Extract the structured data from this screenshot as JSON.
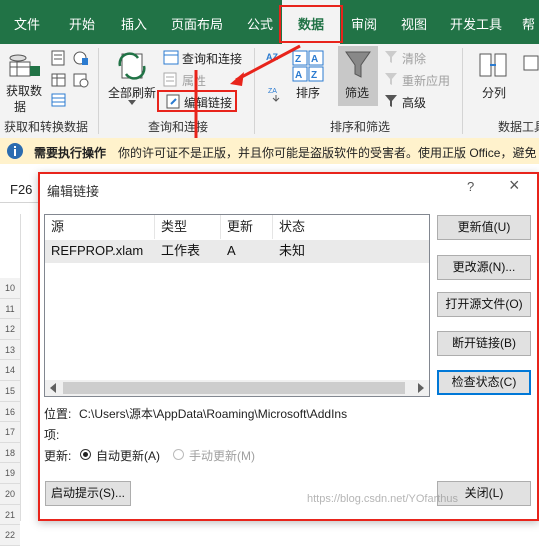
{
  "ribbon": {
    "tabs": [
      "文件",
      "开始",
      "插入",
      "页面布局",
      "公式",
      "数据",
      "审阅",
      "视图",
      "开发工具",
      "帮"
    ],
    "active_tab": "数据",
    "get_transform": {
      "get_data": "获取数",
      "get_data2": "据",
      "group_label": "获取和转换数据"
    },
    "queries": {
      "refresh_all": "全部刷新",
      "queries_connections": "查询和连接",
      "properties": "属性",
      "edit_links": "编辑链接",
      "group_label": "查询和连接"
    },
    "sort_filter": {
      "sort": "排序",
      "filter": "筛选",
      "clear": "清除",
      "reapply": "重新应用",
      "advanced": "高级",
      "group_label": "排序和筛选"
    },
    "data_tools": {
      "split": "分列",
      "group_label": "数据工具"
    },
    "sort_az_top": "AZ",
    "sort_za_top": "ZA"
  },
  "infobar": {
    "title": "需要执行操作",
    "message": "你的许可证不是正版，并且你可能是盗版软件的受害者。使用正版 Office，避免"
  },
  "formula_bar": {
    "cell_ref": "F26"
  },
  "grid": {
    "row_numbers": [
      "10",
      "11",
      "12",
      "13",
      "14",
      "15",
      "16",
      "17",
      "18",
      "19",
      "20",
      "21",
      "22"
    ]
  },
  "dialog": {
    "title": "编辑链接",
    "help": "?",
    "close": "×",
    "columns": [
      "源",
      "类型",
      "更新",
      "状态"
    ],
    "rows": [
      {
        "source": "REFPROP.xlam",
        "type": "工作表",
        "update": "A",
        "status": "未知"
      }
    ],
    "buttons": {
      "update_values": "更新值(U)",
      "change_source": "更改源(N)...",
      "open_source": "打开源文件(O)",
      "break_link": "断开链接(B)",
      "check_status": "检查状态(C)",
      "startup_prompt": "启动提示(S)...",
      "close": "关闭(L)"
    },
    "location_label": "位置:",
    "location_value": "C:\\Users\\源本\\AppData\\Roaming\\Microsoft\\AddIns",
    "item_label": "项:",
    "update_label": "更新:",
    "auto_update": "自动更新(A)",
    "manual_update": "手动更新(M)"
  },
  "watermark": "https://blog.csdn.net/YOfarthus",
  "colors": {
    "excel_green": "#217346",
    "highlight_red": "#e8241b",
    "info_yellow": "#fff2cc",
    "accent_blue": "#0078d7"
  }
}
